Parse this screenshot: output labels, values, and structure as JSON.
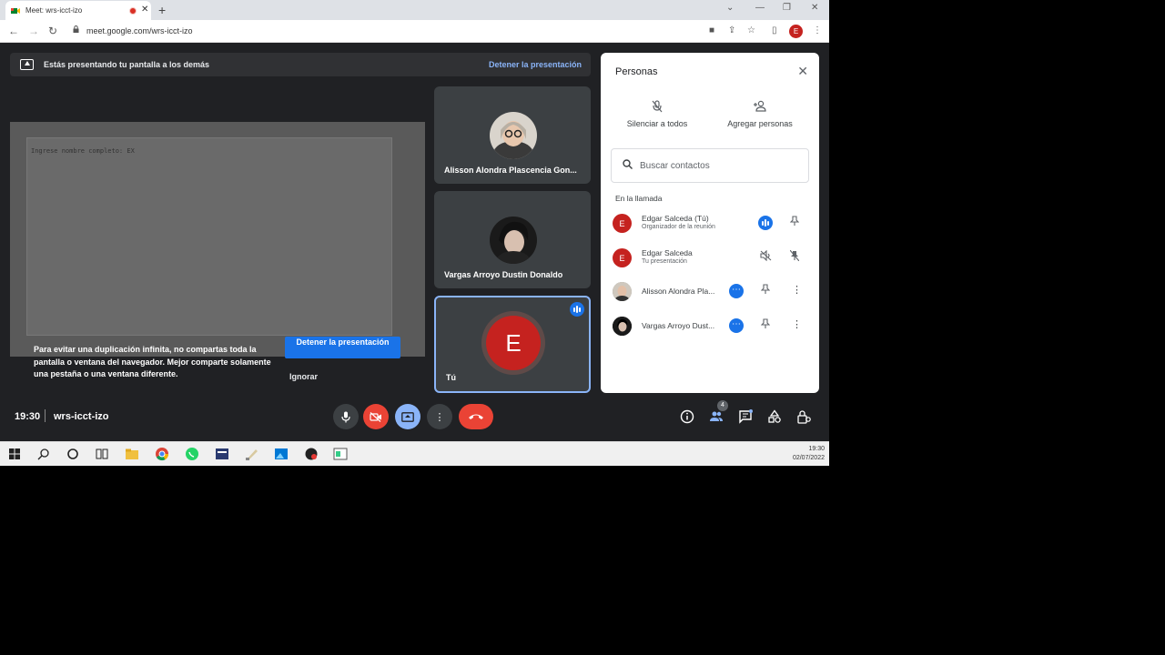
{
  "browser": {
    "tab_title": "Meet: wrs-icct-izo",
    "tab_close": "✕",
    "new_tab": "+",
    "url": "meet.google.com/wrs-icct-izo",
    "profile_initial": "E",
    "window_minimize": "—",
    "window_restore": "❐",
    "window_close": "✕"
  },
  "banner": {
    "text": "Estás presentando tu pantalla a los demás",
    "stop_link": "Detener la presentación"
  },
  "presentation": {
    "code_line": "Ingrese nombre completo: EX",
    "warning": "Para evitar una duplicación infinita, no compartas toda la pantalla o ventana del navegador. Mejor comparte solamente una pestaña o una ventana diferente.",
    "stop_button": "Detener la presentación",
    "ignore_button": "Ignorar"
  },
  "tiles": [
    {
      "name": "Alisson Alondra Plascencia Gon..."
    },
    {
      "name": "Vargas Arroyo Dustin Donaldo"
    },
    {
      "name": "Tú",
      "initial": "E"
    }
  ],
  "people_panel": {
    "title": "Personas",
    "mute_all": "Silenciar a todos",
    "add_people": "Agregar personas",
    "search_placeholder": "Buscar contactos",
    "section": "En la llamada",
    "participants": [
      {
        "initial": "E",
        "name": "Edgar Salceda (Tú)",
        "subtitle": "Organizador de la reunión"
      },
      {
        "initial": "E",
        "name": "Edgar Salceda",
        "subtitle": "Tu presentación"
      },
      {
        "initial": "",
        "name": "Alisson Alondra Pla...",
        "subtitle": ""
      },
      {
        "initial": "",
        "name": "Vargas Arroyo Dust...",
        "subtitle": ""
      }
    ]
  },
  "bottom_bar": {
    "time": "19:30",
    "meeting_code": "wrs-icct-izo",
    "participants_count": "4"
  },
  "taskbar": {
    "time": "19:30",
    "date": "02/07/2022"
  },
  "colors": {
    "accent": "#1a73e8",
    "hangup": "#ea4335",
    "background": "#202124"
  }
}
